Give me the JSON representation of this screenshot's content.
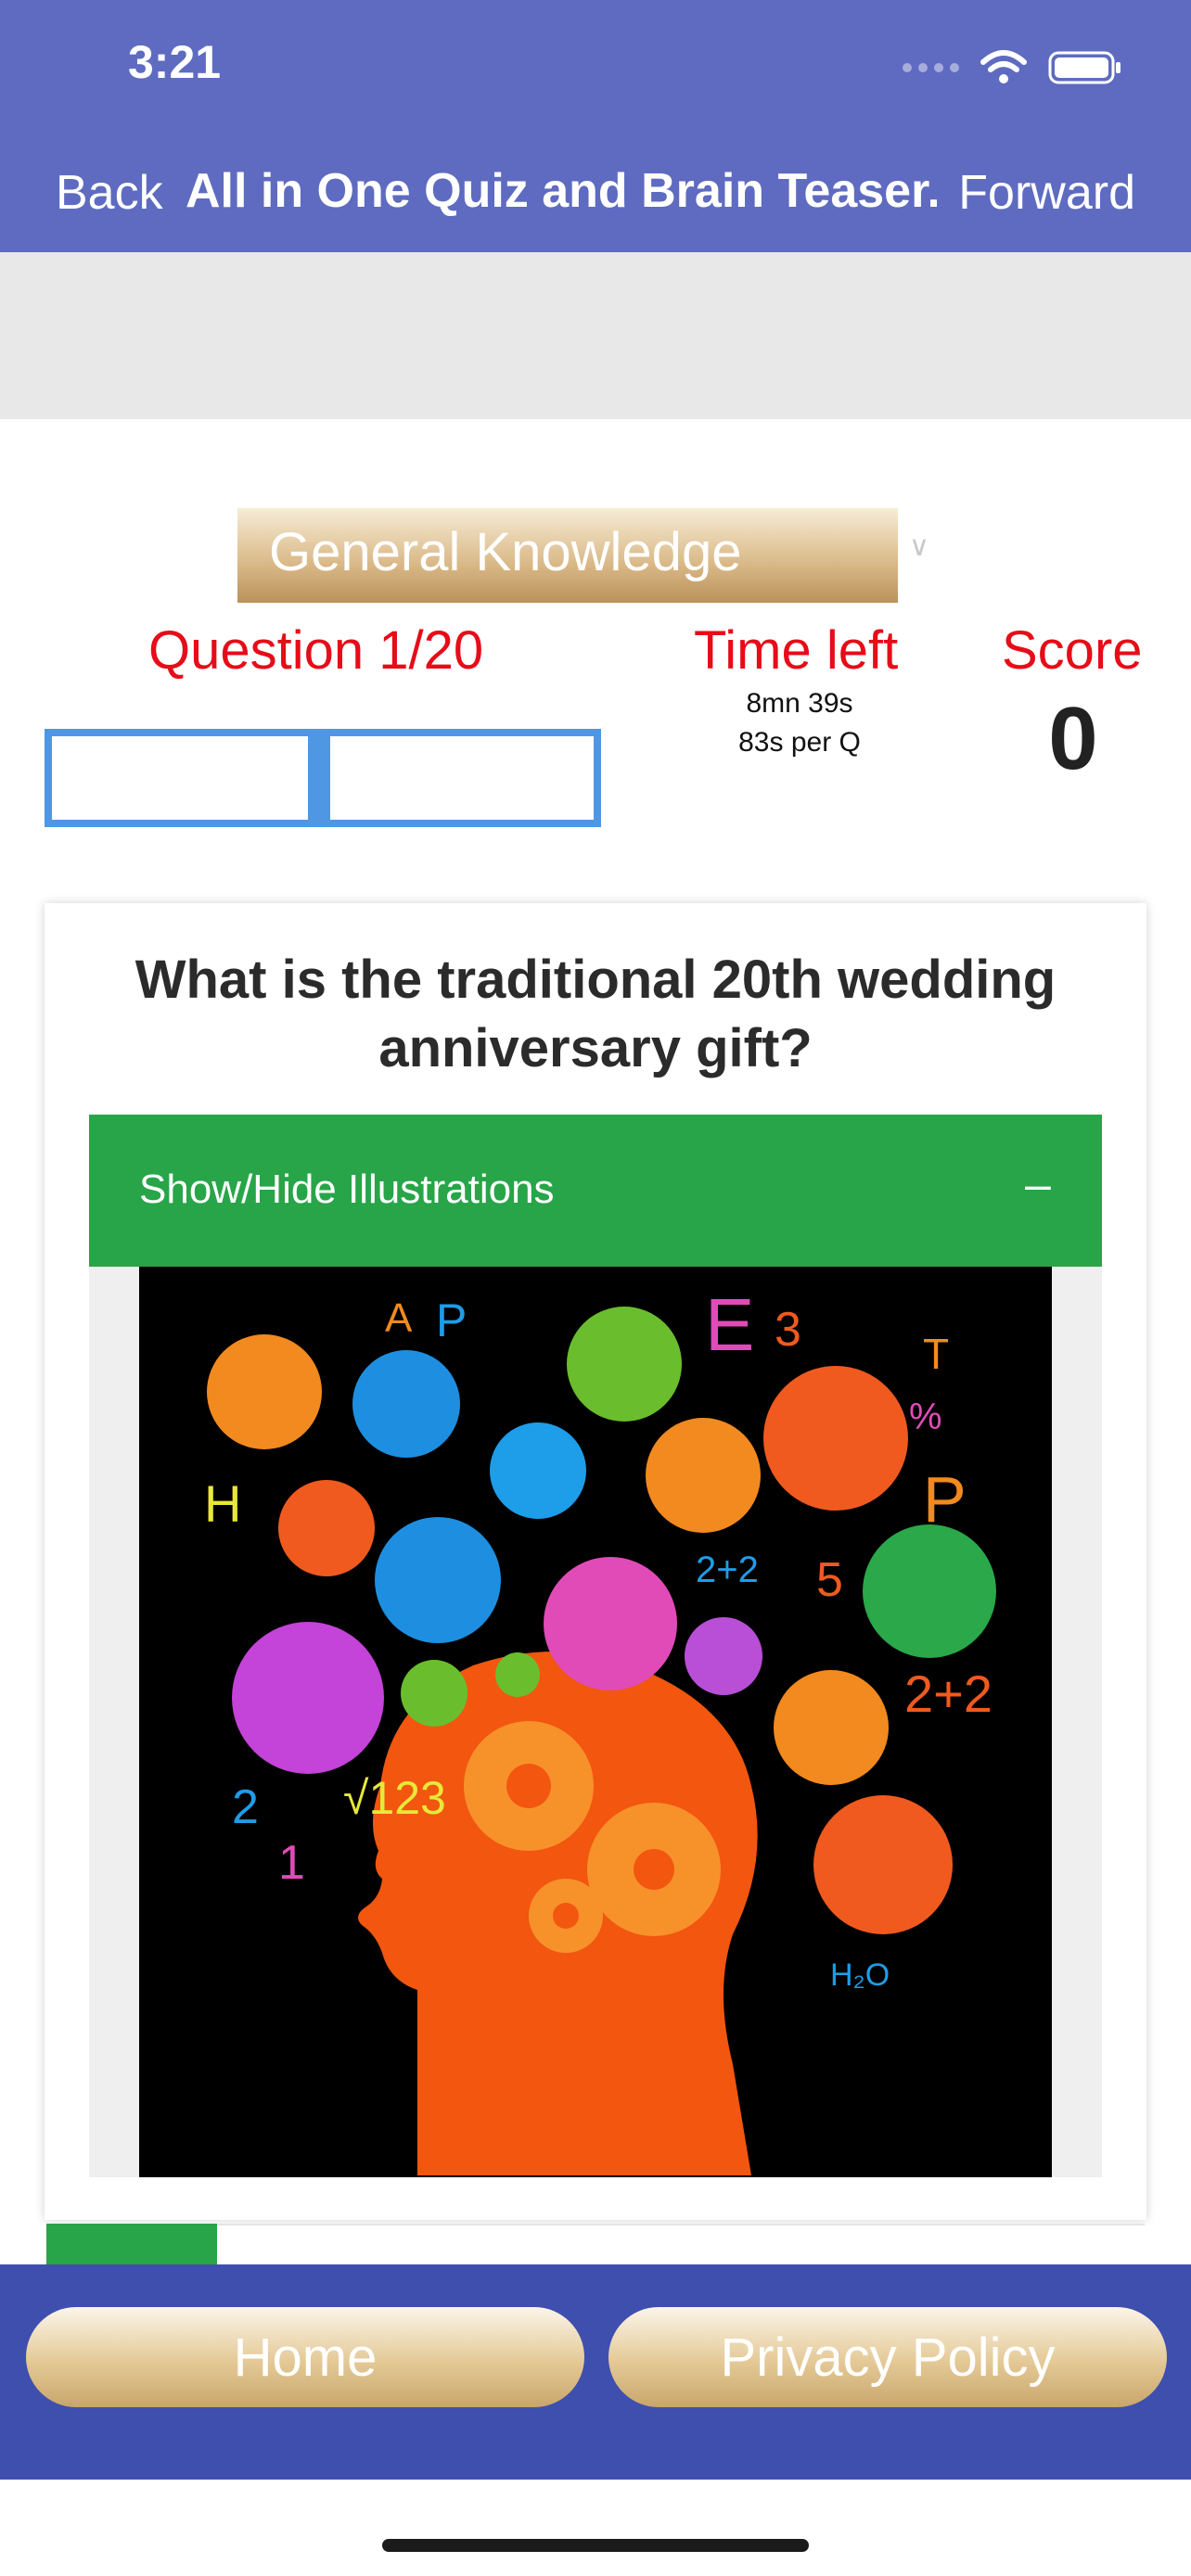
{
  "status_bar": {
    "time": "3:21"
  },
  "nav": {
    "back": "Back",
    "title": "All in One Quiz and Brain Teaser...",
    "forward": "Forward"
  },
  "category": {
    "selected": "General Knowledge"
  },
  "quiz": {
    "question_label": "Question 1/20",
    "time_left_label": "Time left",
    "time_remaining": "8mn 39s",
    "per_question": "83s per Q",
    "score_label": "Score",
    "score_value": "0",
    "progress": 0
  },
  "question": {
    "text": "What is the traditional 20th wedding anniversary gift?",
    "illustrations_label": "Show/Hide Illustrations",
    "illustrations_toggle": "–"
  },
  "bottom": {
    "home": "Home",
    "privacy": "Privacy Policy"
  },
  "colors": {
    "nav_bar": "#5e6bc0",
    "bottom_bar": "#3f4fad",
    "accent_red": "#e60c18",
    "progress_border": "#4f97e3",
    "green_header": "#27a548"
  }
}
